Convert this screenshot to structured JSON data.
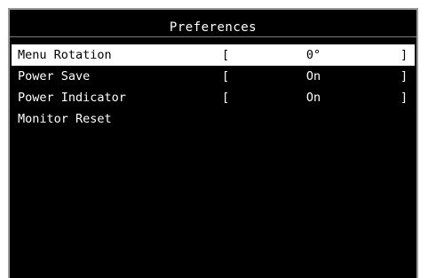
{
  "window": {
    "title": "Preferences"
  },
  "menu": {
    "items": [
      {
        "label": "Menu Rotation",
        "open_bracket": "[",
        "value": "0°",
        "close_bracket": "]",
        "selected": true
      },
      {
        "label": "Power Save",
        "open_bracket": "[",
        "value": "On",
        "close_bracket": "]",
        "selected": false
      },
      {
        "label": "Power Indicator",
        "open_bracket": "[",
        "value": "On",
        "close_bracket": "]",
        "selected": false
      },
      {
        "label": "Monitor Reset",
        "selected": false
      }
    ]
  },
  "colors": {
    "background": "#000000",
    "text": "#ffffff",
    "highlight": "#ffffff",
    "highlight_text": "#000000",
    "frame": "#9a9a9a"
  }
}
